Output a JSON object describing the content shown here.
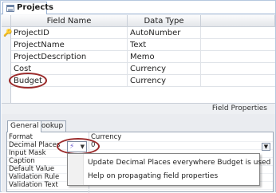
{
  "tab": {
    "title": "Projects"
  },
  "grid": {
    "headers": [
      "Field Name",
      "Data Type"
    ],
    "rows": [
      {
        "name": "ProjectID",
        "type": "AutoNumber"
      },
      {
        "name": "ProjectName",
        "type": "Text"
      },
      {
        "name": "ProjectDescription",
        "type": "Memo"
      },
      {
        "name": "Cost",
        "type": "Currency"
      },
      {
        "name": "Budget",
        "type": "Currency"
      }
    ]
  },
  "field_properties": {
    "label": "Field Properties"
  },
  "property_tabs": [
    "General",
    "Lookup"
  ],
  "properties": [
    {
      "label": "Format",
      "value": "Currency"
    },
    {
      "label": "Decimal Places",
      "value": "0"
    },
    {
      "label": "Input Mask",
      "value": ""
    },
    {
      "label": "Caption",
      "value": ""
    },
    {
      "label": "Default Value",
      "value": ""
    },
    {
      "label": "Validation Rule",
      "value": ""
    },
    {
      "label": "Validation Text",
      "value": ""
    }
  ],
  "smart_tag_menu": {
    "items": [
      "Update Decimal Places everywhere Budget is used",
      "Help on propagating field properties"
    ]
  },
  "colors": {
    "accent": "#9b2b2b",
    "border": "#9bb2d2"
  }
}
